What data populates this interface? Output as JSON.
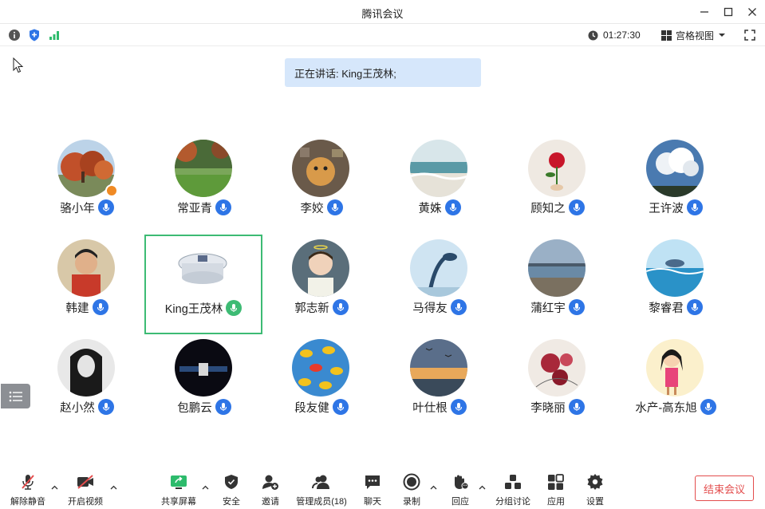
{
  "window": {
    "title": "腾讯会议"
  },
  "status": {
    "timer": "01:27:30",
    "view_label": "宫格视图"
  },
  "speaking_banner": "正在讲话: King王茂林;",
  "participants": [
    {
      "name": "骆小年",
      "mic": "on",
      "host": true
    },
    {
      "name": "常亚青",
      "mic": "on"
    },
    {
      "name": "李姣",
      "mic": "on"
    },
    {
      "name": "黄姝",
      "mic": "on"
    },
    {
      "name": "顾知之",
      "mic": "on"
    },
    {
      "name": "王许波",
      "mic": "on"
    },
    {
      "name": "韩建",
      "mic": "on"
    },
    {
      "name": "King王茂林",
      "mic": "speaking",
      "active": true
    },
    {
      "name": "郭志新",
      "mic": "on"
    },
    {
      "name": "马得友",
      "mic": "on"
    },
    {
      "name": "蒲红宇",
      "mic": "on"
    },
    {
      "name": "黎睿君",
      "mic": "on"
    },
    {
      "name": "赵小然",
      "mic": "on"
    },
    {
      "name": "包鹏云",
      "mic": "on"
    },
    {
      "name": "段友健",
      "mic": "on"
    },
    {
      "name": "叶仕根",
      "mic": "on"
    },
    {
      "name": "李晓丽",
      "mic": "on"
    },
    {
      "name": "水产-高东旭",
      "mic": "on"
    }
  ],
  "toolbar": {
    "unmute": "解除静音",
    "start_video": "开启视频",
    "share_screen": "共享屏幕",
    "security": "安全",
    "invite": "邀请",
    "manage_members": "管理成员(18)",
    "chat": "聊天",
    "record": "录制",
    "react": "回应",
    "breakout": "分组讨论",
    "apps": "应用",
    "settings": "设置",
    "end_meeting": "结束会议"
  },
  "colors": {
    "accent": "#2e75e6",
    "active_border": "#3dbb74",
    "end_red": "#e34d4d",
    "banner_bg": "#d6e7fb"
  }
}
